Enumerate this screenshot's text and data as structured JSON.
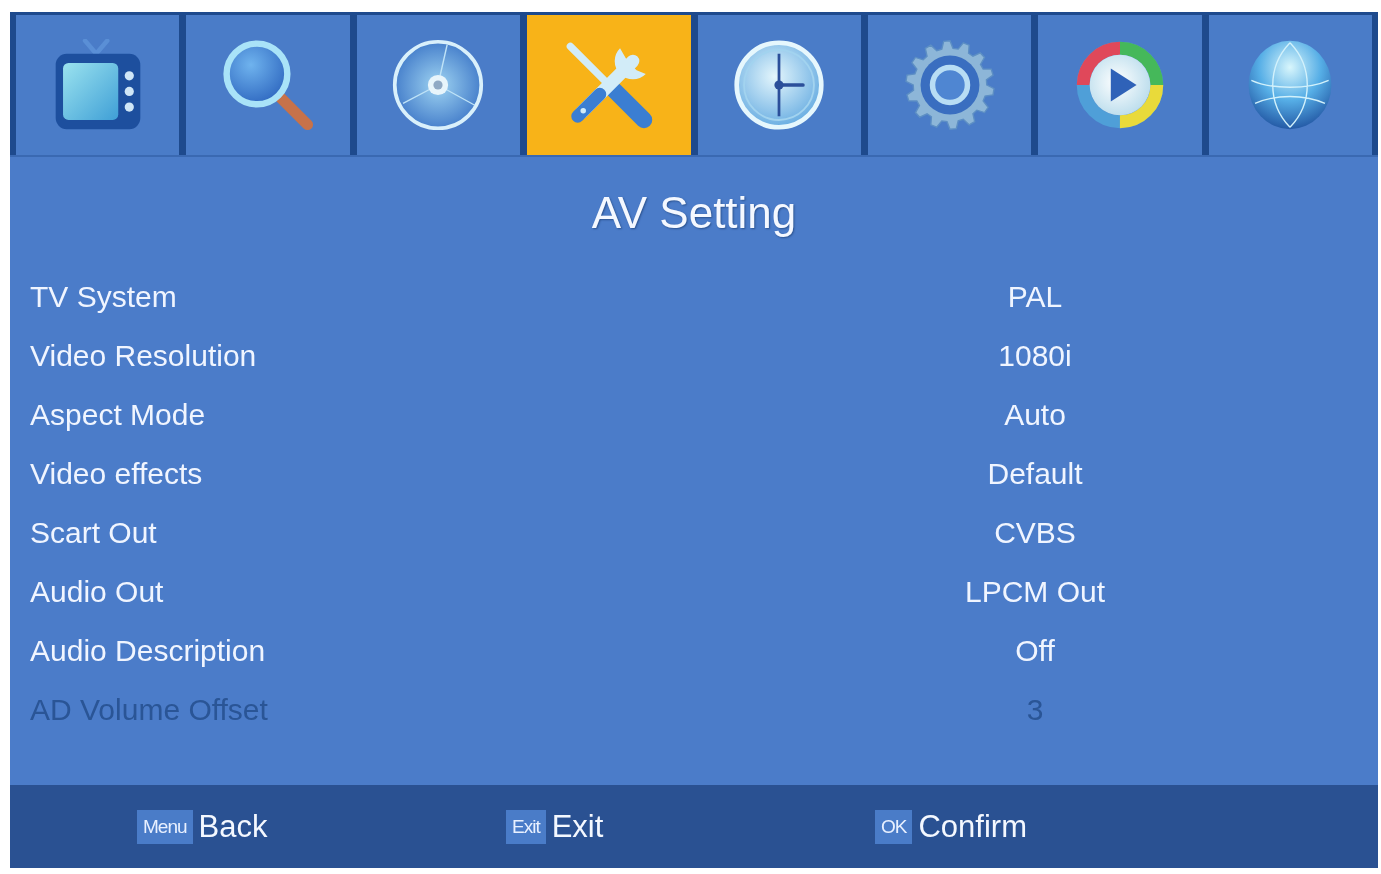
{
  "tabs": [
    {
      "selected": false
    },
    {
      "selected": false
    },
    {
      "selected": false
    },
    {
      "selected": true
    },
    {
      "selected": false
    },
    {
      "selected": false
    },
    {
      "selected": false
    },
    {
      "selected": false
    }
  ],
  "title": "AV Setting",
  "rows": [
    {
      "label": "TV System",
      "value": "PAL",
      "disabled": false
    },
    {
      "label": "Video Resolution",
      "value": "1080i",
      "disabled": false
    },
    {
      "label": "Aspect Mode",
      "value": "Auto",
      "disabled": false
    },
    {
      "label": "Video effects",
      "value": "Default",
      "disabled": false
    },
    {
      "label": "Scart Out",
      "value": "CVBS",
      "disabled": false
    },
    {
      "label": "Audio Out",
      "value": "LPCM Out",
      "disabled": false
    },
    {
      "label": "Audio Description",
      "value": "Off",
      "disabled": false
    },
    {
      "label": "AD Volume Offset",
      "value": "3",
      "disabled": true
    }
  ],
  "footer": [
    {
      "key": "Menu",
      "action": "Back"
    },
    {
      "key": "Exit",
      "action": "Exit"
    },
    {
      "key": "OK",
      "action": "Confirm"
    }
  ]
}
